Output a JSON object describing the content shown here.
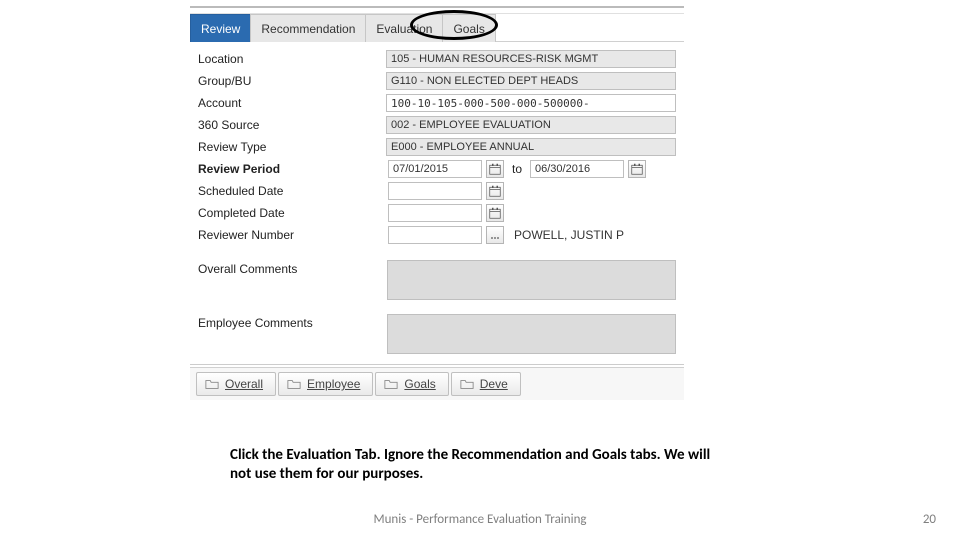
{
  "tabs": [
    "Review",
    "Recommendation",
    "Evaluation",
    "Goals"
  ],
  "active_tab_index": 0,
  "form": {
    "location": {
      "label": "Location",
      "value": "105 - HUMAN RESOURCES-RISK MGMT"
    },
    "group_bu": {
      "label": "Group/BU",
      "value": "G110 - NON ELECTED DEPT HEADS"
    },
    "account": {
      "label": "Account",
      "value": "100-10-105-000-500-000-500000-"
    },
    "source_360": {
      "label": "360 Source",
      "value": "002 - EMPLOYEE EVALUATION"
    },
    "review_type": {
      "label": "Review Type",
      "value": "E000 - EMPLOYEE ANNUAL"
    },
    "review_period": {
      "label": "Review Period",
      "from": "07/01/2015",
      "to_label": "to",
      "to": "06/30/2016"
    },
    "scheduled_date": {
      "label": "Scheduled Date",
      "value": ""
    },
    "completed_date": {
      "label": "Completed Date",
      "value": ""
    },
    "reviewer_number": {
      "label": "Reviewer Number",
      "value": "",
      "name": "POWELL, JUSTIN P"
    },
    "overall_comments": {
      "label": "Overall Comments"
    },
    "employee_comments": {
      "label": "Employee Comments"
    }
  },
  "subtabs": [
    "Overall",
    "Employee",
    "Goals",
    "Deve"
  ],
  "instruction": "Click the Evaluation Tab.  Ignore the Recommendation and Goals tabs.  We will not use them for our purposes.",
  "footer": "Munis - Performance Evaluation Training",
  "page_number": "20"
}
